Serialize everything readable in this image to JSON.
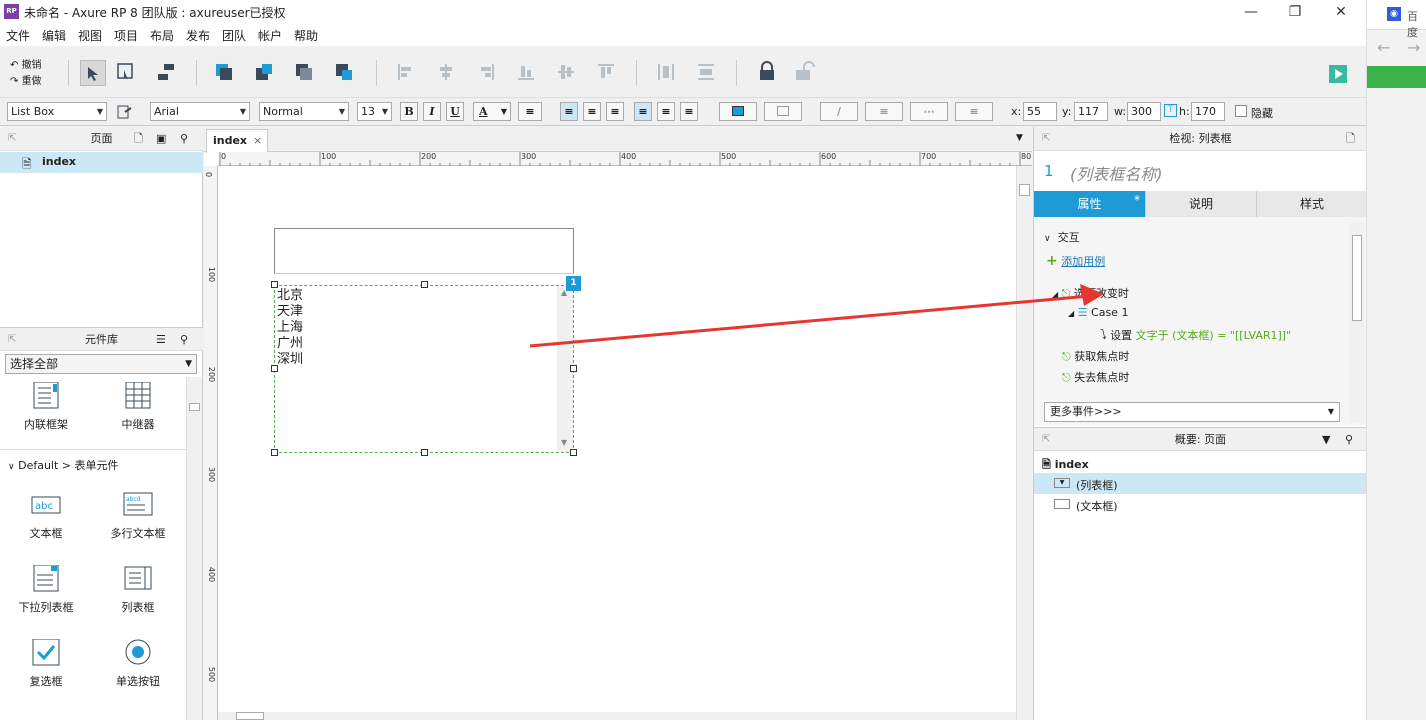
{
  "window": {
    "title": "未命名 - Axure RP 8 团队版 : axureuser已授权",
    "app_icon": "RP"
  },
  "menu": [
    "文件",
    "编辑",
    "视图",
    "项目",
    "布局",
    "发布",
    "团队",
    "帐户",
    "帮助"
  ],
  "toolbar": {
    "undo_label": "撤销",
    "redo_label": "重做"
  },
  "format": {
    "widget_type": "List Box",
    "font": "Arial",
    "style": "Normal",
    "size": "13",
    "bold": "B",
    "italic": "I",
    "underline": "U",
    "color_a": "A",
    "x_label": "x:",
    "x": "55",
    "y_label": "y:",
    "y": "117",
    "w_label": "w:",
    "w": "300",
    "h_label": "h:",
    "h": "170",
    "hide_label": "隐藏"
  },
  "pages_panel": {
    "title": "页面",
    "items": [
      "index"
    ]
  },
  "library_panel": {
    "title": "元件库",
    "select": "选择全部",
    "top_items": [
      "内联框架",
      "中继器"
    ],
    "section": "Default > 表单元件",
    "items": [
      "文本框",
      "多行文本框",
      "下拉列表框",
      "列表框",
      "复选框",
      "单选按钮"
    ]
  },
  "canvas": {
    "tab": "index",
    "ruler_x": [
      "0",
      "100",
      "200",
      "300",
      "400",
      "500",
      "600",
      "700",
      "80"
    ],
    "ruler_y": [
      "0",
      "100",
      "200",
      "300",
      "400",
      "500"
    ],
    "listbox_options": [
      "北京",
      "天津",
      "上海",
      "广州",
      "深圳"
    ],
    "badge": "1"
  },
  "inspector": {
    "title": "检视: 列表框",
    "number": "1",
    "name_placeholder": "(列表框名称)",
    "tabs": [
      "属性",
      "说明",
      "样式"
    ],
    "tab_marker": "*",
    "interactions_label": "交互",
    "add_case": "添加用例",
    "event_selection_changed": "选项改变时",
    "case_label": "Case 1",
    "action_prefix": "设置",
    "action_text": "文字于 (文本框) = \"[[LVAR1]]\"",
    "event_focus": "获取焦点时",
    "event_blur": "失去焦点时",
    "more_events": "更多事件>>>"
  },
  "outline": {
    "title": "概要: 页面",
    "page": "index",
    "items": [
      "(列表框)",
      "(文本框)"
    ]
  },
  "browser": {
    "tab_text": "百度"
  },
  "colors": {
    "accent": "#1e9bd7",
    "green": "#59a818",
    "arrow": "#e8352f",
    "select_bg": "#cce8f7"
  }
}
